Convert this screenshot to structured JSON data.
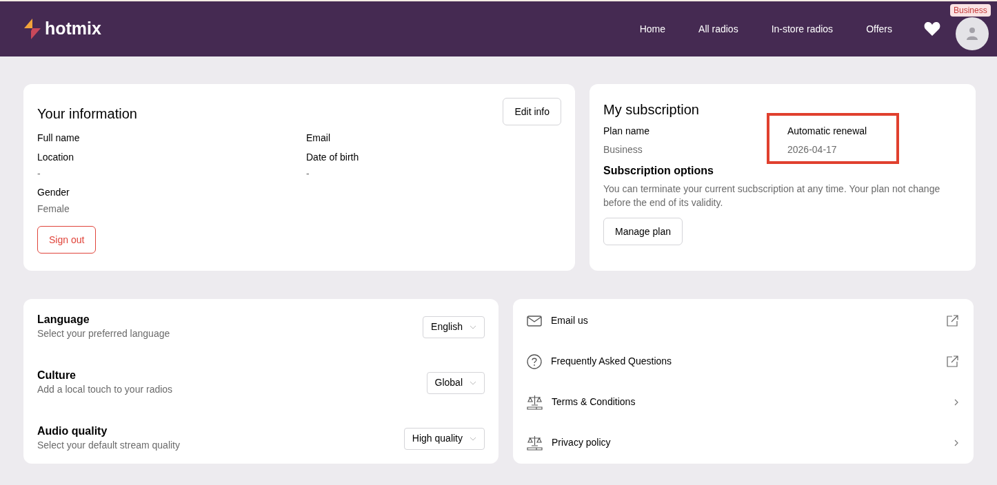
{
  "brand": "hotmix",
  "nav": [
    {
      "label": "Home"
    },
    {
      "label": "All radios"
    },
    {
      "label": "In-store radios"
    },
    {
      "label": "Offers"
    }
  ],
  "account_badge": "Business",
  "info": {
    "title": "Your information",
    "edit_button": "Edit info",
    "fields": [
      {
        "label": "Full name"
      },
      {
        "label": "Email"
      },
      {
        "label": "Location",
        "value": "-"
      },
      {
        "label": "Date of birth",
        "value": "-"
      },
      {
        "label": "Gender",
        "value": "Female"
      }
    ],
    "sign_out": "Sign out"
  },
  "subscription": {
    "title": "My subscription",
    "plan_label": "Plan name",
    "plan_value": "Business",
    "renewal_label": "Automatic renewal",
    "renewal_value": "2026-04-17",
    "options_title": "Subscription options",
    "options_text": "You can terminate your current sucbscription at any time. Your plan not change before the end of its validity.",
    "manage_button": "Manage plan"
  },
  "settings": [
    {
      "title": "Language",
      "description": "Select your preferred language",
      "value": "English"
    },
    {
      "title": "Culture",
      "description": "Add a local touch to your radios",
      "value": "Global"
    },
    {
      "title": "Audio quality",
      "description": "Select your default stream quality",
      "value": "High quality"
    }
  ],
  "links": [
    {
      "label": "Email us",
      "kind": "external"
    },
    {
      "label": "Frequently Asked Questions",
      "kind": "external"
    },
    {
      "label": "Terms & Conditions",
      "kind": "chevron"
    },
    {
      "label": "Privacy policy",
      "kind": "chevron"
    }
  ]
}
